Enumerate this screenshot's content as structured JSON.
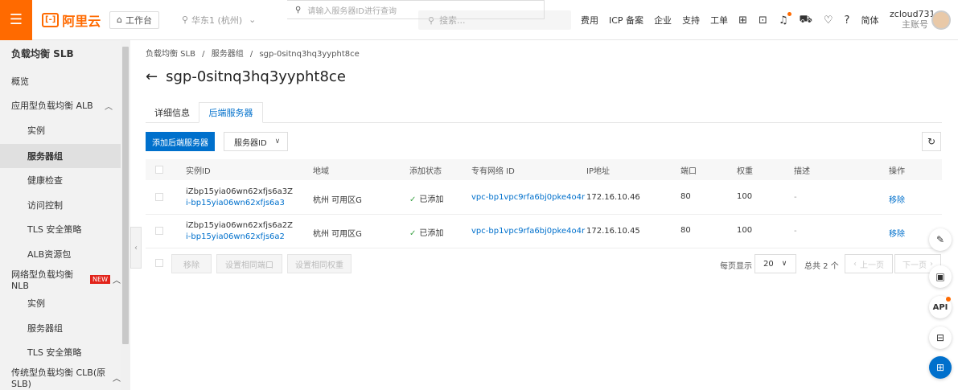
{
  "topbar": {
    "menu_icon": "☰",
    "logo_mark": "[-]",
    "logo_text": "阿里云",
    "workbench_label": "工作台",
    "region_label": "华东1 (杭州)",
    "search_placeholder": "搜索...",
    "links": [
      "费用",
      "ICP 备案",
      "企业",
      "支持",
      "工单"
    ],
    "lang": "简体",
    "username": "zcloud731",
    "account_type": "主账号"
  },
  "sidebar": {
    "title": "负载均衡 SLB",
    "overview": "概览",
    "alb_group": "应用型负载均衡 ALB",
    "alb_items": [
      "实例",
      "服务器组",
      "健康检查",
      "访问控制",
      "TLS 安全策略",
      "ALB资源包"
    ],
    "nlb_group": "网络型负载均衡 NLB",
    "new_badge": "NEW",
    "nlb_items": [
      "实例",
      "服务器组",
      "TLS 安全策略"
    ],
    "clb_group": "传统型负载均衡 CLB(原SLB)"
  },
  "breadcrumb": [
    "负载均衡 SLB",
    "服务器组",
    "sgp-0sitnq3hq3yypht8ce"
  ],
  "page_title": "sgp-0sitnq3hq3yypht8ce",
  "tabs": [
    "详细信息",
    "后端服务器"
  ],
  "toolbar": {
    "add_button": "添加后端服务器",
    "filter_field": "服务器ID",
    "search_placeholder": "请输入服务器ID进行查询"
  },
  "table": {
    "headers": [
      "实例ID",
      "地域",
      "添加状态",
      "专有网络 ID",
      "IP地址",
      "端口",
      "权重",
      "描述",
      "操作"
    ],
    "rows": [
      {
        "name": "iZbp15yia06wn62xfjs6a3Z",
        "id": "i-bp15yia06wn62xfjs6a3",
        "region": "杭州 可用区G",
        "status": "已添加",
        "vpc": "vpc-bp1vpc9rfa6bj0pke4o4r",
        "ip": "172.16.10.46",
        "port": "80",
        "weight": "100",
        "desc": "-",
        "action": "移除"
      },
      {
        "name": "iZbp15yia06wn62xfjs6a2Z",
        "id": "i-bp15yia06wn62xfjs6a2",
        "region": "杭州 可用区G",
        "status": "已添加",
        "vpc": "vpc-bp1vpc9rfa6bj0pke4o4r",
        "ip": "172.16.10.45",
        "port": "80",
        "weight": "100",
        "desc": "-",
        "action": "移除"
      }
    ]
  },
  "footer": {
    "remove": "移除",
    "set_port": "设置相同端口",
    "set_weight": "设置相同权重",
    "per_page_label": "每页显示",
    "per_page": "20",
    "total": "总共 2 个",
    "prev": "上一页",
    "next": "下一页"
  },
  "floating": {
    "api_label": "API"
  },
  "colors": {
    "brand": "#ff6a00",
    "primary": "#0070cc",
    "success": "#3ca246",
    "new_badge": "#e2231a"
  }
}
